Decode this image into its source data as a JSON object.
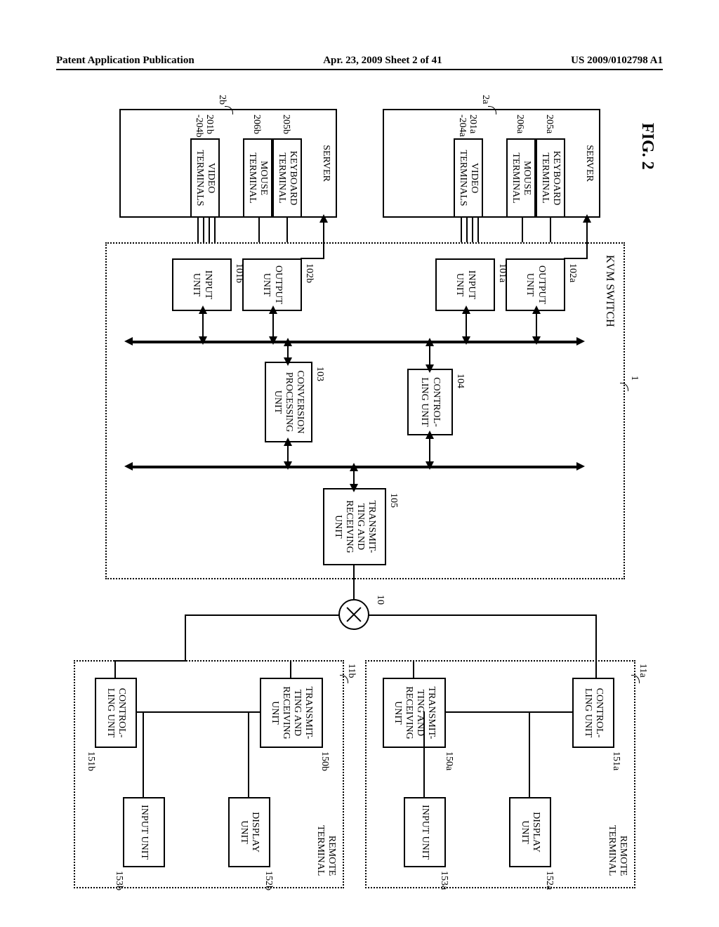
{
  "header": {
    "left": "Patent Application Publication",
    "center": "Apr. 23, 2009  Sheet 2 of 41",
    "right": "US 2009/0102798 A1"
  },
  "figure": {
    "number": "FIG. 2"
  },
  "kvm": {
    "title": "KVM SWITCH",
    "ref": "1",
    "transmit": "TRANSMIT-\nTING AND\nRECEIVING\nUNIT",
    "transmit_ref": "105",
    "control": "CONTROL-\nLING UNIT",
    "control_ref": "104",
    "conversion": "CONVERSION\nPROCESSING\nUNIT",
    "conversion_ref": "103",
    "outputA": "OUTPUT\nUNIT",
    "outputA_ref": "102a",
    "inputA": "INPUT\nUNIT",
    "inputA_ref": "101a",
    "outputB": "OUTPUT\nUNIT",
    "outputB_ref": "102b",
    "inputB": "INPUT\nUNIT",
    "inputB_ref": "101b"
  },
  "serverA": {
    "title": "SERVER",
    "ref": "2a",
    "keyboard": "KEYBOARD\nTERMINAL",
    "keyboard_ref": "205a",
    "mouse": "MOUSE\nTERMINAL",
    "mouse_ref": "206a",
    "video": "VIDEO\nTERMINALS",
    "video_ref": "201a\n-204a"
  },
  "serverB": {
    "title": "SERVER",
    "ref": "2b",
    "keyboard": "KEYBOARD\nTERMINAL",
    "keyboard_ref": "205b",
    "mouse": "MOUSE\nTERMINAL",
    "mouse_ref": "206b",
    "video": "VIDEO\nTERMINALS",
    "video_ref": "201b\n-204b"
  },
  "network": {
    "ref": "10"
  },
  "terminalA": {
    "title": "REMOTE\nTERMINAL",
    "ref": "11a",
    "control": "CONTROL-\nLING UNIT",
    "control_ref": "151a",
    "transmit": "TRANSMIT-\nTING AND\nRECEIVING\nUNIT",
    "transmit_ref": "150a",
    "display": "DISPLAY\nUNIT",
    "display_ref": "152a",
    "input": "INPUT\nUNIT",
    "input_ref": "153a"
  },
  "terminalB": {
    "title": "REMOTE\nTERMINAL",
    "ref": "11b",
    "control": "CONTROL-\nLING UNIT",
    "control_ref": "151b",
    "transmit": "TRANSMIT-\nTING AND\nRECEIVING\nUNIT",
    "transmit_ref": "150b",
    "display": "DISPLAY\nUNIT",
    "display_ref": "152b",
    "input": "INPUT\nUNIT",
    "input_ref": "153b"
  }
}
